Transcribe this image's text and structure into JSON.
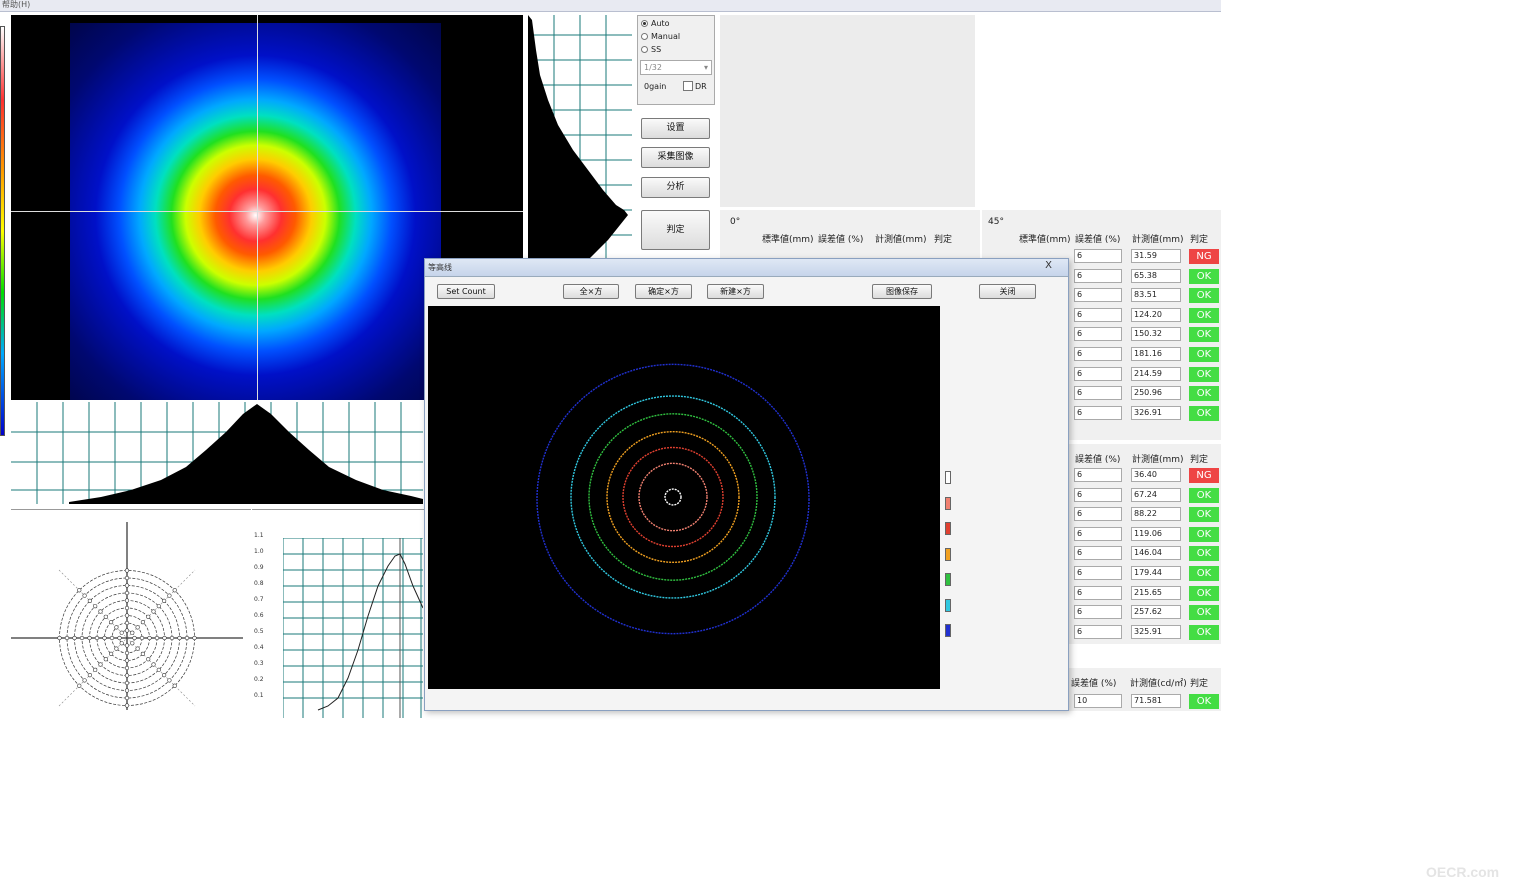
{
  "menubar": {
    "label": "帮助(H)"
  },
  "camera_panel": {
    "mode_options": [
      {
        "label": "Auto",
        "selected": true
      },
      {
        "label": "Manual",
        "selected": false
      },
      {
        "label": "SS",
        "selected": false
      }
    ],
    "shutter_value": "1/32",
    "gain_label": "0gain",
    "dr_label": "DR"
  },
  "side_buttons": [
    {
      "label": "设置"
    },
    {
      "label": "采集图像"
    },
    {
      "label": "分析"
    },
    {
      "label": "判定"
    }
  ],
  "table_0deg": {
    "title": "0°",
    "headers": [
      "標準値(mm)",
      "誤差値 (%)",
      "計測値(mm)",
      "判定"
    ]
  },
  "table_45deg": {
    "title": "45°",
    "headers": [
      "標準値(mm)",
      "誤差値 (%)",
      "計測値(mm)",
      "判定"
    ],
    "rows": [
      {
        "err": "6",
        "meas": "31.59",
        "judge": "NG"
      },
      {
        "err": "6",
        "meas": "65.38",
        "judge": "OK"
      },
      {
        "err": "6",
        "meas": "83.51",
        "judge": "OK"
      },
      {
        "err": "6",
        "meas": "124.20",
        "judge": "OK"
      },
      {
        "err": "6",
        "meas": "150.32",
        "judge": "OK"
      },
      {
        "err": "6",
        "meas": "181.16",
        "judge": "OK"
      },
      {
        "err": "6",
        "meas": "214.59",
        "judge": "OK"
      },
      {
        "err": "6",
        "meas": "250.96",
        "judge": "OK"
      },
      {
        "err": "6",
        "meas": "326.91",
        "judge": "OK"
      }
    ]
  },
  "table_second": {
    "headers": [
      "誤差値 (%)",
      "計測値(mm)",
      "判定"
    ],
    "rows": [
      {
        "err": "6",
        "meas": "36.40",
        "judge": "NG"
      },
      {
        "err": "6",
        "meas": "67.24",
        "judge": "OK"
      },
      {
        "err": "6",
        "meas": "88.22",
        "judge": "OK"
      },
      {
        "err": "6",
        "meas": "119.06",
        "judge": "OK"
      },
      {
        "err": "6",
        "meas": "146.04",
        "judge": "OK"
      },
      {
        "err": "6",
        "meas": "179.44",
        "judge": "OK"
      },
      {
        "err": "6",
        "meas": "215.65",
        "judge": "OK"
      },
      {
        "err": "6",
        "meas": "257.62",
        "judge": "OK"
      },
      {
        "err": "6",
        "meas": "325.91",
        "judge": "OK"
      }
    ]
  },
  "table_third": {
    "headers": [
      "誤差値 (%)",
      "計測値(cd/㎡)",
      "判定"
    ],
    "rows": [
      {
        "err": "10",
        "meas": "71.581",
        "judge": "OK"
      }
    ]
  },
  "dialog": {
    "title": "等高线",
    "close_label": "X",
    "buttons": [
      "Set Count",
      "全×方",
      "确定×方",
      "新建×方",
      "图像保存",
      "关闭"
    ],
    "legend_colors": [
      "#ffffff",
      "#f08070",
      "#e04030",
      "#f0a020",
      "#30c040",
      "#30c8e0",
      "#2030d0"
    ]
  },
  "polar_chart": {
    "rings": 9
  },
  "profile_chart": {
    "y_ticks": [
      "1.1",
      "1.0",
      "0.9",
      "0.8",
      "0.7",
      "0.6",
      "0.5",
      "0.4",
      "0.3",
      "0.2",
      "0.1"
    ]
  },
  "watermark": "OECR.com"
}
